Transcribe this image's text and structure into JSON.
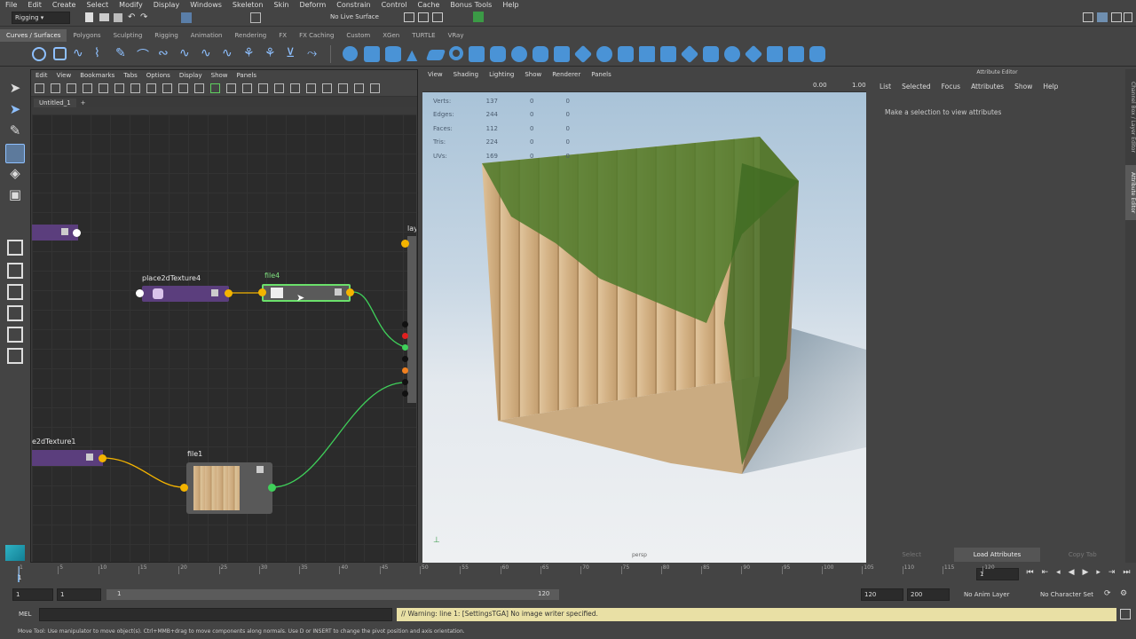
{
  "menubar": [
    "File",
    "Edit",
    "Create",
    "Select",
    "Modify",
    "Display",
    "Windows",
    "Skeleton",
    "Skin",
    "Deform",
    "Constrain",
    "Control",
    "Cache",
    "Bonus Tools",
    "Help"
  ],
  "status": {
    "mode": "Rigging",
    "live_surface": "No Live Surface"
  },
  "shelf_tabs": [
    {
      "label": "Curves / Surfaces",
      "active": true
    },
    {
      "label": "Polygons"
    },
    {
      "label": "Sculpting"
    },
    {
      "label": "Rigging"
    },
    {
      "label": "Animation"
    },
    {
      "label": "Rendering"
    },
    {
      "label": "FX"
    },
    {
      "label": "FX Caching"
    },
    {
      "label": "Custom"
    },
    {
      "label": "XGen"
    },
    {
      "label": "TURTLE"
    },
    {
      "label": "VRay"
    }
  ],
  "hypershade": {
    "menu": [
      "Edit",
      "View",
      "Bookmarks",
      "Tabs",
      "Options",
      "Display",
      "Show",
      "Panels"
    ],
    "tab": "Untitled_1",
    "tab_add": "+",
    "nodes": {
      "place2d_top": "place2dTexture4",
      "file4": "file4",
      "layer_partial": "lay",
      "place2d_bottom": "e2dTexture1",
      "file1": "file1"
    }
  },
  "viewport": {
    "menu": [
      "View",
      "Shading",
      "Lighting",
      "Show",
      "Renderer",
      "Panels"
    ],
    "field_a": "0.00",
    "field_b": "1.00",
    "camera": "persp",
    "hud": [
      {
        "label": "Verts:",
        "a": "137",
        "b": "0",
        "c": "0"
      },
      {
        "label": "Edges:",
        "a": "244",
        "b": "0",
        "c": "0"
      },
      {
        "label": "Faces:",
        "a": "112",
        "b": "0",
        "c": "0"
      },
      {
        "label": "Tris:",
        "a": "224",
        "b": "0",
        "c": "0"
      },
      {
        "label": "UVs:",
        "a": "169",
        "b": "0",
        "c": "0"
      }
    ]
  },
  "attribute_editor": {
    "title": "Attribute Editor",
    "menu": [
      "List",
      "Selected",
      "Focus",
      "Attributes",
      "Show",
      "Help"
    ],
    "message": "Make a selection to view attributes",
    "buttons": [
      "Select",
      "Load Attributes",
      "Copy Tab"
    ]
  },
  "side_tabs": [
    "Channel Box / Layer Editor",
    "Attribute Editor"
  ],
  "timeline": {
    "ticks": [
      "1",
      "5",
      "10",
      "15",
      "20",
      "25",
      "30",
      "35",
      "40",
      "45",
      "50",
      "55",
      "60",
      "65",
      "70",
      "75",
      "80",
      "85",
      "90",
      "95",
      "100",
      "105",
      "110",
      "115",
      "120"
    ],
    "current": "1",
    "current_field": "1",
    "range_start": "1",
    "playback_start": "1",
    "slider_start": "1",
    "slider_end": "120",
    "playback_end": "120",
    "range_end": "200",
    "anim_layer": "No Anim Layer",
    "char_set": "No Character Set"
  },
  "command": {
    "lang": "MEL",
    "warning": "// Warning: line 1: [SettingsTGA] No image writer specified."
  },
  "helpline": "Move Tool: Use manipulator to move object(s). Ctrl+MMB+drag to move components along normals. Use D or INSERT to change the pivot position and axis orientation."
}
